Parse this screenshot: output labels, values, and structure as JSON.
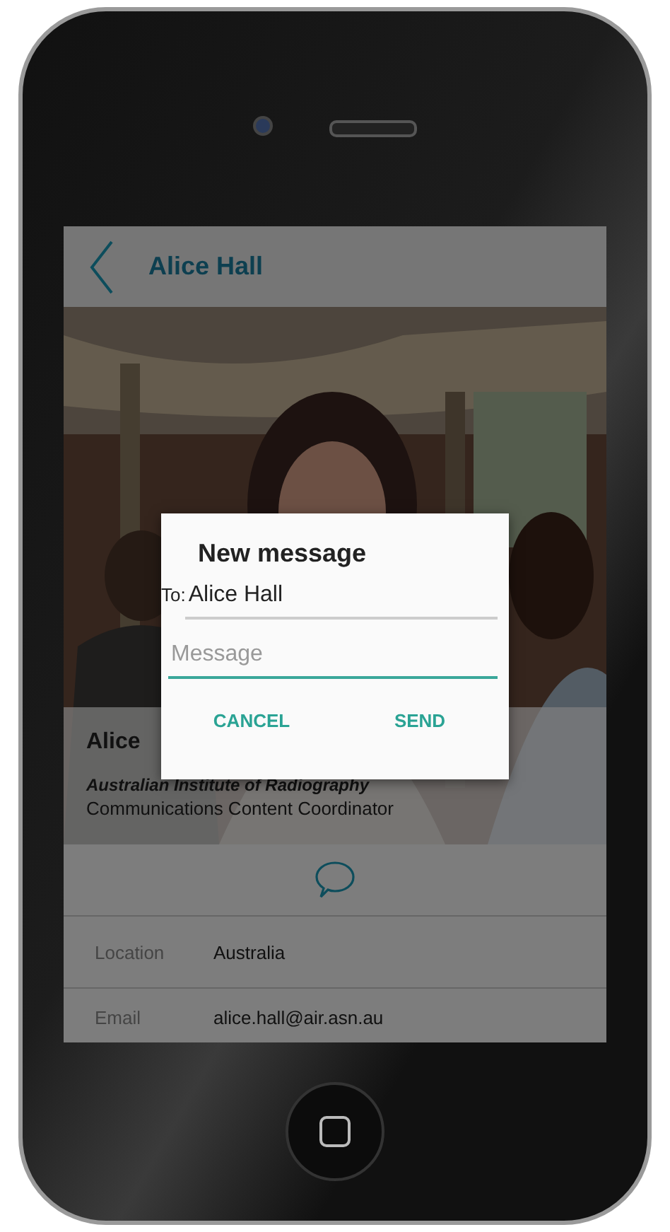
{
  "header": {
    "title": "Alice Hall"
  },
  "profile": {
    "name": "Alice",
    "organization": "Australian Institute of Radiography",
    "position": "Communications Content Coordinator"
  },
  "details": [
    {
      "label": "Location",
      "value": "Australia"
    },
    {
      "label": "Email",
      "value": "alice.hall@air.asn.au"
    }
  ],
  "dialog": {
    "title": "New message",
    "to_label": "To:",
    "to_value": "Alice Hall",
    "message": {
      "placeholder": "Message"
    },
    "buttons": [
      "CANCEL",
      "SEND"
    ]
  }
}
